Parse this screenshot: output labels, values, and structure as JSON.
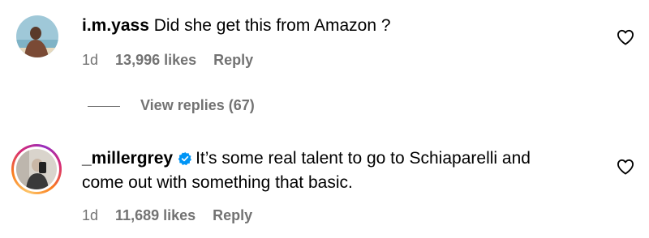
{
  "comments": [
    {
      "username": "i.m.yass",
      "text": "Did she get this from Amazon ?",
      "time": "1d",
      "likes": "13,996 likes",
      "reply": "Reply",
      "verified": false
    },
    {
      "username": "_millergrey",
      "text_line1": "It’s some real talent to go to Schiaparelli and",
      "text_line2": "come out with something that basic.",
      "time": "1d",
      "likes": "11,689 likes",
      "reply": "Reply",
      "verified": true
    }
  ],
  "view_replies": "View replies (67)",
  "colors": {
    "muted": "#737373",
    "verified": "#0095f6"
  }
}
